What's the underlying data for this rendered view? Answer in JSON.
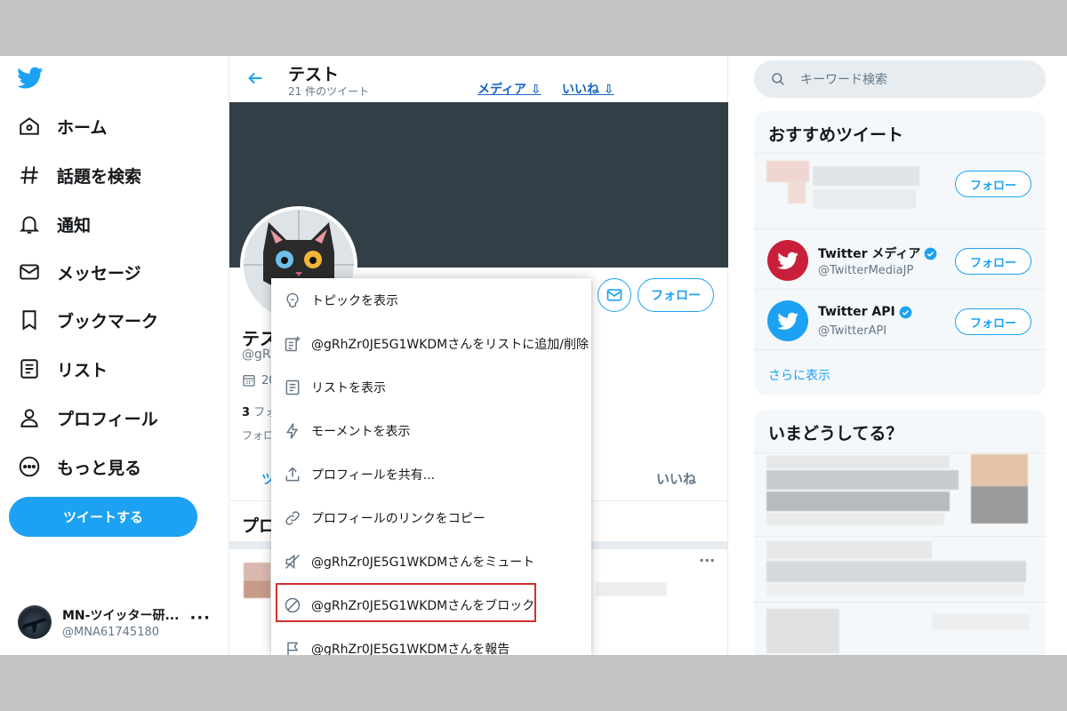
{
  "nav": {
    "items": [
      {
        "label": "ホーム",
        "icon": "home-icon"
      },
      {
        "label": "話題を検索",
        "icon": "hashtag-icon"
      },
      {
        "label": "通知",
        "icon": "bell-icon"
      },
      {
        "label": "メッセージ",
        "icon": "envelope-icon"
      },
      {
        "label": "ブックマーク",
        "icon": "bookmark-icon"
      },
      {
        "label": "リスト",
        "icon": "list-icon"
      },
      {
        "label": "プロフィール",
        "icon": "person-icon"
      },
      {
        "label": "もっと見る",
        "icon": "more-circle-icon"
      }
    ],
    "tweet_button": "ツイートする",
    "account": {
      "name": "MN-ツイッター研...",
      "handle": "@MNA61745180"
    }
  },
  "header": {
    "title": "テスト",
    "subtitle": "21 件のツイート",
    "link_media": "メディア ⇩",
    "link_likes": "いいね ⇩"
  },
  "profile": {
    "name_partial": "テス",
    "handle_partial": "@gRh",
    "joined_partial": "20",
    "following_count": "3",
    "following_partial": "フォ",
    "followers_partial": "フォロ",
    "follow_button": "フォロー",
    "tab_tweets_partial": "ツ",
    "tab_likes": "いいね",
    "pinned_partial": "プロ"
  },
  "menu": {
    "items": [
      {
        "label": "トピックを表示",
        "icon": "topic-icon"
      },
      {
        "label": "@gRhZr0JE5G1WKDMさんをリストに追加/削除",
        "icon": "list-add-icon"
      },
      {
        "label": "リストを表示",
        "icon": "list-icon"
      },
      {
        "label": "モーメントを表示",
        "icon": "lightning-icon"
      },
      {
        "label": "プロフィールを共有...",
        "icon": "share-icon"
      },
      {
        "label": "プロフィールのリンクをコピー",
        "icon": "link-icon"
      },
      {
        "label": "@gRhZr0JE5G1WKDMさんをミュート",
        "icon": "mute-icon"
      },
      {
        "label": "@gRhZr0JE5G1WKDMさんをブロック",
        "icon": "block-icon"
      },
      {
        "label": "@gRhZr0JE5G1WKDMさんを報告",
        "icon": "flag-icon"
      }
    ],
    "highlight_color": "#d32f2f"
  },
  "right": {
    "search_placeholder": "キーワード検索",
    "recommend_title": "おすすめツイート",
    "follow_label": "フォロー",
    "accounts": [
      {
        "name": "Twitter メディア",
        "handle": "@TwitterMediaJP",
        "verified": true
      },
      {
        "name": "Twitter API",
        "handle": "@TwitterAPI",
        "verified": true
      }
    ],
    "show_more": "さらに表示",
    "trends_title": "いまどうしてる？"
  },
  "colors": {
    "accent": "#1da1f2",
    "link": "#1565c0",
    "banner": "#333f46"
  }
}
